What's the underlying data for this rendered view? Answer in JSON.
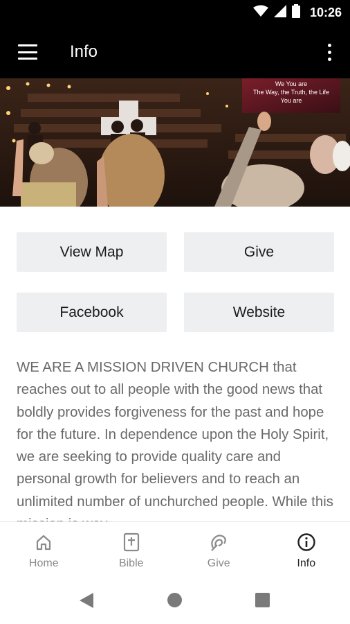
{
  "status_bar": {
    "time": "10:26",
    "icons": [
      "wifi-icon",
      "signal-icon",
      "battery-icon"
    ]
  },
  "app_bar": {
    "title": "Info",
    "menu_icon": "hamburger-menu-icon",
    "overflow_icon": "more-vert-icon"
  },
  "hero": {
    "screen_text": [
      "We You are",
      "The Way, the Truth, the Life",
      "You are"
    ]
  },
  "actions": {
    "view_map": "View Map",
    "give": "Give",
    "facebook": "Facebook",
    "website": "Website"
  },
  "description": "WE ARE A MISSION DRIVEN CHURCH that reaches out to all people with the good news that boldly provides forgiveness for the past and hope for the future. In dependence upon the Holy Spirit, we are seeking to provide quality care and personal growth for believers and to reach an unlimited number of unchurched people. While this mission is way",
  "bottom_nav": {
    "items": [
      {
        "label": "Home",
        "icon": "home-icon"
      },
      {
        "label": "Bible",
        "icon": "bible-icon"
      },
      {
        "label": "Give",
        "icon": "give-icon"
      },
      {
        "label": "Info",
        "icon": "info-icon"
      }
    ],
    "active": "Info"
  },
  "colors": {
    "app_bar": "#000000",
    "button_bg": "#eeeff1",
    "body_text": "#6a6a6a",
    "nav_inactive": "#8a8a8a",
    "nav_active": "#222222"
  }
}
